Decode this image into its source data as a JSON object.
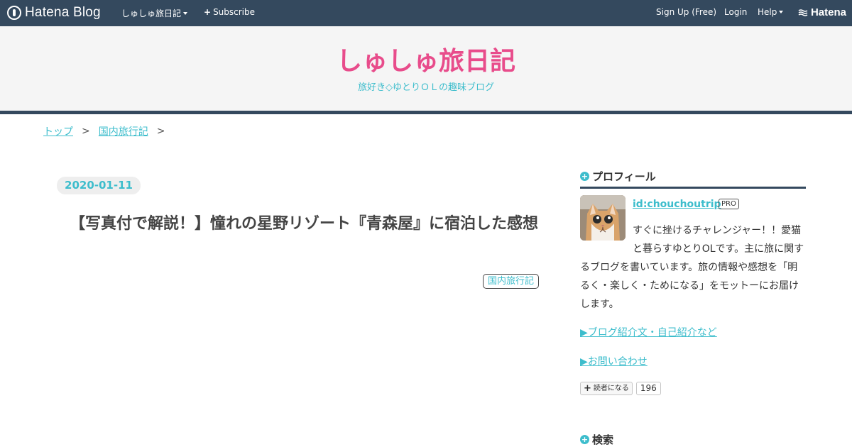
{
  "globalbar": {
    "logo_text": "Hatena Blog",
    "blog_menu": "しゅしゅ旅日記",
    "subscribe": "Subscribe",
    "signup": "Sign Up (Free)",
    "login": "Login",
    "help": "Help",
    "hatena": "Hatena",
    "bg_color": "#34495e"
  },
  "header": {
    "title": "しゅしゅ旅日記",
    "description": "旅好き◇ゆとりＯＬの趣味ブログ",
    "title_color": "#e84c8b",
    "accent_color": "#3dbdcc"
  },
  "breadcrumb": {
    "items": [
      "トップ",
      "国内旅行記"
    ],
    "separator": ">"
  },
  "article": {
    "date": "2020-01-11",
    "title": "【写真付で解説！】憧れの星野リゾート『青森屋』に宿泊した感想",
    "category": "国内旅行記"
  },
  "sidebar": {
    "profile": {
      "heading": "プロフィール",
      "user_id": "id:chouchoutrip",
      "badge": "PRO",
      "description": "すぐに挫けるチャレンジャー！！愛猫と暮らすゆとりOLです。主に旅に関するブログを書いています。旅の情報や感想を「明るく・楽しく・ためになる」をモットーにお届けします。",
      "link_intro": "▶ブログ紹介文・自己紹介など",
      "link_contact": "▶お問い合わせ",
      "reader_button": "読者になる",
      "reader_count": "196"
    },
    "search": {
      "heading": "検索"
    }
  }
}
